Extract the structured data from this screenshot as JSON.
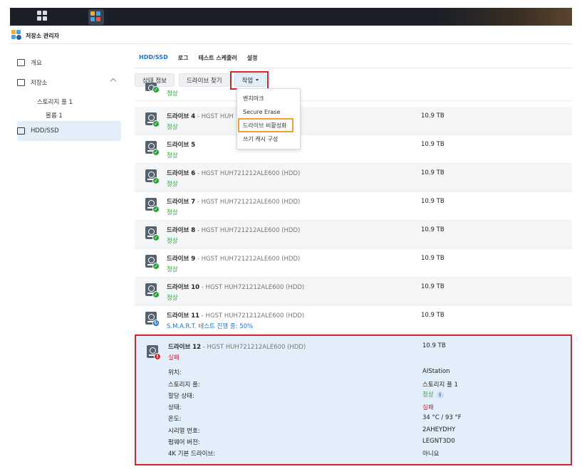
{
  "app": {
    "title": "저장소 관리자"
  },
  "sidebar": {
    "items": [
      {
        "label": "개요"
      },
      {
        "label": "저장소"
      },
      {
        "label": "HDD/SSD"
      }
    ],
    "sub": {
      "pool": "스토리지 풀 1",
      "volume": "볼륨 1"
    }
  },
  "tabs": [
    {
      "label": "HDD/SSD"
    },
    {
      "label": "로그"
    },
    {
      "label": "테스트 스케줄러"
    },
    {
      "label": "설정"
    }
  ],
  "toolbar": {
    "status_info": "상태 정보",
    "find_drive": "드라이브 찾기",
    "action": "작업"
  },
  "dropdown": [
    {
      "label": "벤치마크"
    },
    {
      "label": "Secure Erase"
    },
    {
      "label": "드라이브 비활성화"
    },
    {
      "label": "쓰기 캐시 구성"
    }
  ],
  "drives": [
    {
      "name": "",
      "model": "",
      "status": "정상",
      "size": ""
    },
    {
      "name": "드라이브 4",
      "model": " - HGST HUH",
      "status": "정상",
      "size": "10.9 TB"
    },
    {
      "name": "드라이브 5",
      "model": "",
      "status": "정상",
      "size": "10.9 TB"
    },
    {
      "name": "드라이브 6",
      "model": " - HGST HUH721212ALE600 (HDD)",
      "status": "정상",
      "size": "10.9 TB"
    },
    {
      "name": "드라이브 7",
      "model": " - HGST HUH721212ALE600 (HDD)",
      "status": "정상",
      "size": "10.9 TB"
    },
    {
      "name": "드라이브 8",
      "model": " - HGST HUH721212ALE600 (HDD)",
      "status": "정상",
      "size": "10.9 TB"
    },
    {
      "name": "드라이브 9",
      "model": " - HGST HUH721212ALE600 (HDD)",
      "status": "정상",
      "size": "10.9 TB"
    },
    {
      "name": "드라이브 10",
      "model": " - HGST HUH721212ALE600 (HDD)",
      "status": "정상",
      "size": "10.9 TB"
    },
    {
      "name": "드라이브 11",
      "model": " - HGST HUH721212ALE600 (HDD)",
      "status": "S.M.A.R.T. 테스트 진행 중: 50%",
      "size": "10.9 TB"
    }
  ],
  "selected_drive": {
    "name": "드라이브 12",
    "model": " - HGST HUH721212ALE600 (HDD)",
    "status": "실패",
    "size": "10.9 TB",
    "details": [
      {
        "label": "위치:",
        "value": "AIStation"
      },
      {
        "label": "스토리지 풀:",
        "value": "스토리지 풀 1"
      },
      {
        "label": "할당 상태:",
        "value": "정상"
      },
      {
        "label": "상태:",
        "value": "실패"
      },
      {
        "label": "온도:",
        "value": "34 °C / 93 °F"
      },
      {
        "label": "시리얼 번호:",
        "value": "2AHEYDHY"
      },
      {
        "label": "펌웨어 버전:",
        "value": "LEGNT3D0"
      },
      {
        "label": "4K 기본 드라이브:",
        "value": "아니요"
      }
    ]
  },
  "colors": {
    "accent": "#1a73c8",
    "ok": "#27a33a",
    "fail": "#d6232d",
    "highlight_red": "#d6232d",
    "highlight_orange": "#f0a030"
  }
}
